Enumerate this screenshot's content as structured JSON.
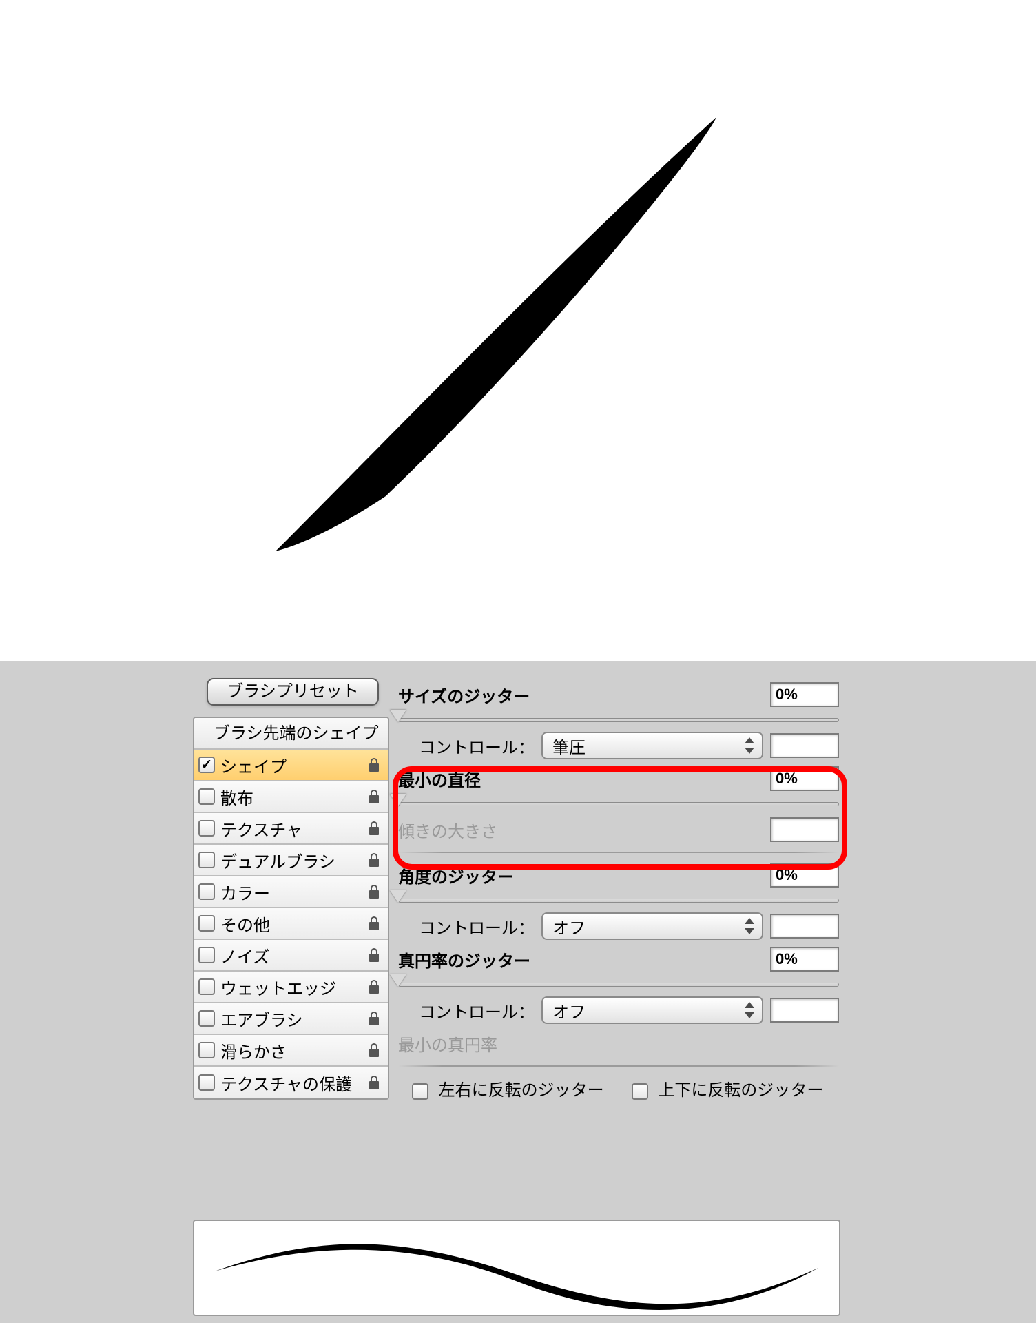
{
  "preset_button_label": "ブラシプリセット",
  "sidebar": {
    "header": "ブラシ先端のシェイプ",
    "items": [
      {
        "label": "シェイプ",
        "checked": true,
        "selected": true
      },
      {
        "label": "散布",
        "checked": false,
        "selected": false
      },
      {
        "label": "テクスチャ",
        "checked": false,
        "selected": false
      },
      {
        "label": "デュアルブラシ",
        "checked": false,
        "selected": false
      },
      {
        "label": "カラー",
        "checked": false,
        "selected": false
      },
      {
        "label": "その他",
        "checked": false,
        "selected": false
      },
      {
        "label": "ノイズ",
        "checked": false,
        "selected": false
      },
      {
        "label": "ウェットエッジ",
        "checked": false,
        "selected": false
      },
      {
        "label": "エアブラシ",
        "checked": false,
        "selected": false
      },
      {
        "label": "滑らかさ",
        "checked": false,
        "selected": false
      },
      {
        "label": "テクスチャの保護",
        "checked": false,
        "selected": false
      }
    ]
  },
  "params": {
    "size_jitter": {
      "title": "サイズのジッター",
      "value": "0%"
    },
    "control1": {
      "label": "コントロール：",
      "value": "筆圧",
      "aux": ""
    },
    "min_diameter": {
      "title": "最小の直径",
      "value": "0%"
    },
    "tilt_scale": {
      "title": "傾きの大きさ",
      "value": ""
    },
    "angle_jitter": {
      "title": "角度のジッター",
      "value": "0%"
    },
    "control2": {
      "label": "コントロール：",
      "value": "オフ",
      "aux": ""
    },
    "roundness_jitter": {
      "title": "真円率のジッター",
      "value": "0%"
    },
    "control3": {
      "label": "コントロール：",
      "value": "オフ",
      "aux": ""
    },
    "min_roundness": {
      "title": "最小の真円率",
      "value": ""
    },
    "flip_x": {
      "label": "左右に反転のジッター",
      "checked": false
    },
    "flip_y": {
      "label": "上下に反転のジッター",
      "checked": false
    }
  }
}
